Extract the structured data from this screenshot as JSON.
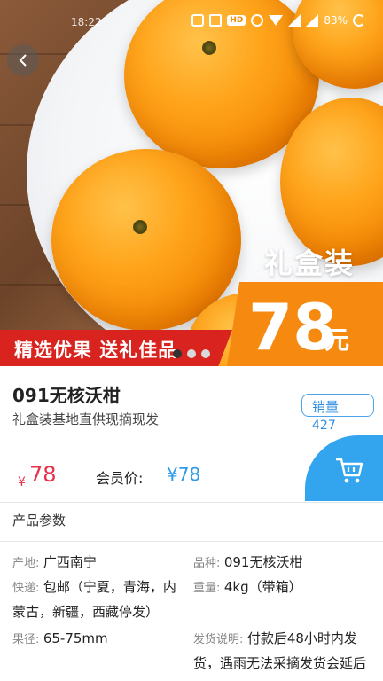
{
  "status_bar": {
    "time": "18:22",
    "battery": "83%"
  },
  "hero": {
    "gift_label": "礼盒装",
    "price_number": "78",
    "price_unit": "元",
    "banner_text": "精选优果  送礼佳品",
    "carousel": {
      "total": 3,
      "active_index": 0
    }
  },
  "product": {
    "name": "091无核沃柑",
    "subtitle": "礼盒装基地直供现摘现发",
    "sales_label": "销量",
    "sales_count": "427",
    "price_symbol": "¥",
    "price": "78",
    "member_label": "会员价:",
    "member_price": "¥78"
  },
  "params": {
    "section_title": "产品参数",
    "origin_key": "产地:",
    "origin_val": "广西南宁",
    "variety_key": "品种:",
    "variety_val": "091无核沃柑",
    "shipping_key": "快递:",
    "shipping_val_line1": "包邮（宁夏，青海，内",
    "shipping_val_line2": "蒙古，新疆，西藏停发）",
    "weight_key": "重量:",
    "weight_val": "4kg（带箱）",
    "diameter_key": "果径:",
    "diameter_val": "65-75mm",
    "delivery_key": "发货说明:",
    "delivery_val_line1": "付款后48小时内发",
    "delivery_val_line2": "货，遇雨无法采摘发货会延后"
  },
  "colors": {
    "accent_orange": "#f68a10",
    "banner_red": "#d8231f",
    "price_red": "#e8304a",
    "member_blue": "#2e9ae8",
    "cart_blue": "#33a4ee"
  },
  "icons": {
    "back": "chevron-left-icon",
    "cart": "shopping-cart-icon"
  }
}
